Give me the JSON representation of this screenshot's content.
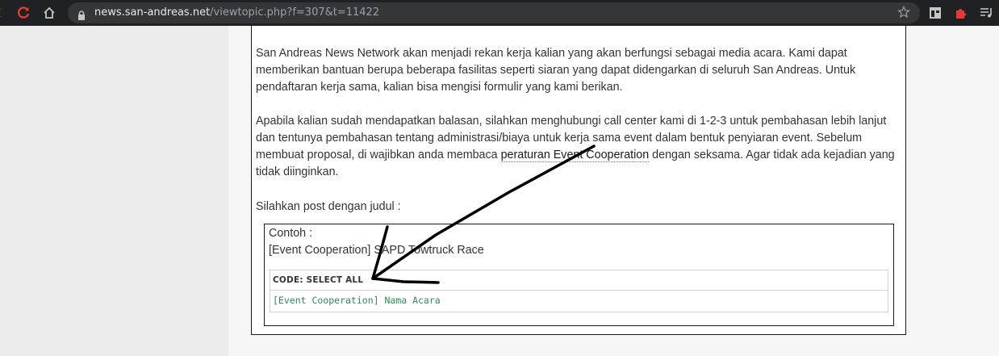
{
  "browser": {
    "url_host": "news.san-andreas.net",
    "url_path": "/viewtopic.php?f=307&t=11422",
    "icons": [
      "back-icon",
      "reload-icon",
      "home-icon",
      "lock-icon",
      "star-icon",
      "extension-icon",
      "puzzle-icon",
      "media-icon"
    ],
    "reload_color": "#e53935"
  },
  "post": {
    "paragraph1": "San Andreas News Network akan menjadi rekan kerja kalian yang akan berfungsi sebagai media acara. Kami dapat memberikan bantuan berupa beberapa fasilitas seperti siaran yang dapat didengarkan di seluruh San Andreas. Untuk pendaftaran kerja sama, kalian bisa mengisi formulir yang kami berikan.",
    "paragraph2_before": "Apabila kalian sudah mendapatkan balasan, silahkan menghubungi call center kami di 1-2-3 untuk pembahasan lebih lanjut dan tentunya pembahasan tentang administrasi/biaya untuk kerja sama event dalam bentuk penyiaran event. Sebelum membuat proposal, di wajibkan anda membaca ",
    "paragraph2_link": "peraturan Event Cooperation",
    "paragraph2_after": " dengan seksama. Agar tidak ada kejadian yang tidak diinginkan.",
    "paragraph3": "Silahkan post dengan judul :",
    "quote": {
      "line1": "Contoh :",
      "line2": "[Event Cooperation] SAPD Towtruck Race",
      "code_header": "CODE: SELECT ALL",
      "code_text": "[Event Cooperation] Nama Acara"
    }
  },
  "colors": {
    "code_text": "#2e8b57",
    "border": "#1a1a1a"
  }
}
